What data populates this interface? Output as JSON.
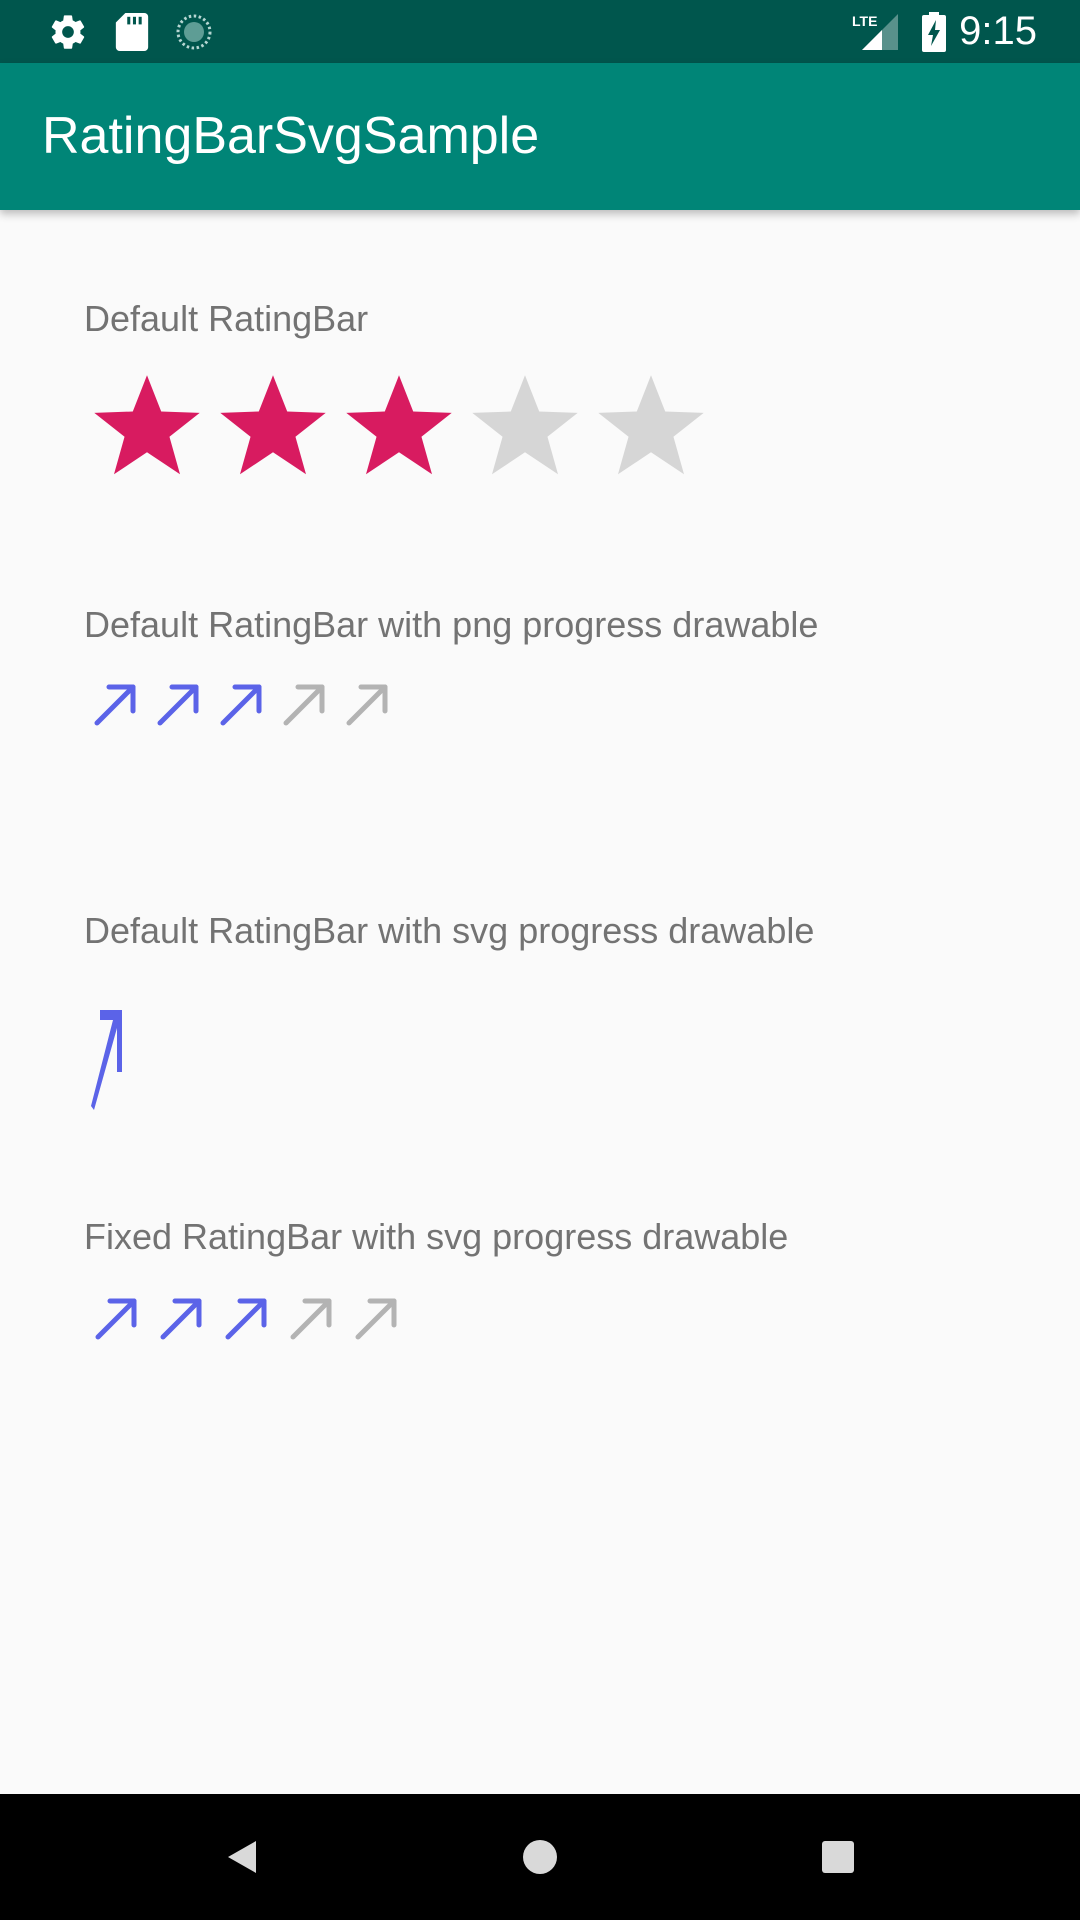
{
  "status_bar": {
    "time": "9:15",
    "network_label": "LTE",
    "icons": [
      "settings-icon",
      "sd-card-icon",
      "sync-icon",
      "signal-icon",
      "battery-charging-icon"
    ]
  },
  "app_bar": {
    "title": "RatingBarSvgSample"
  },
  "sections": [
    {
      "label": "Default RatingBar",
      "rating": 3,
      "max": 5,
      "icon": "star-icon",
      "filled_color": "#d81b60",
      "empty_color": "#d6d6d6"
    },
    {
      "label": "Default RatingBar with png progress drawable",
      "rating": 3,
      "max": 5,
      "icon": "arrow-up-right-icon",
      "filled_color": "#5b63e8",
      "empty_color": "#b3b3b3"
    },
    {
      "label": "Default RatingBar with svg progress drawable",
      "rating": 1,
      "max": 1,
      "icon": "stretched-arrow-icon",
      "filled_color": "#5b63e8"
    },
    {
      "label": "Fixed RatingBar with svg progress drawable",
      "rating": 3,
      "max": 5,
      "icon": "arrow-up-right-icon",
      "filled_color": "#5b63e8",
      "empty_color": "#b3b3b3"
    }
  ],
  "nav_bar": {
    "buttons": [
      "back-icon",
      "home-icon",
      "recents-icon"
    ]
  }
}
